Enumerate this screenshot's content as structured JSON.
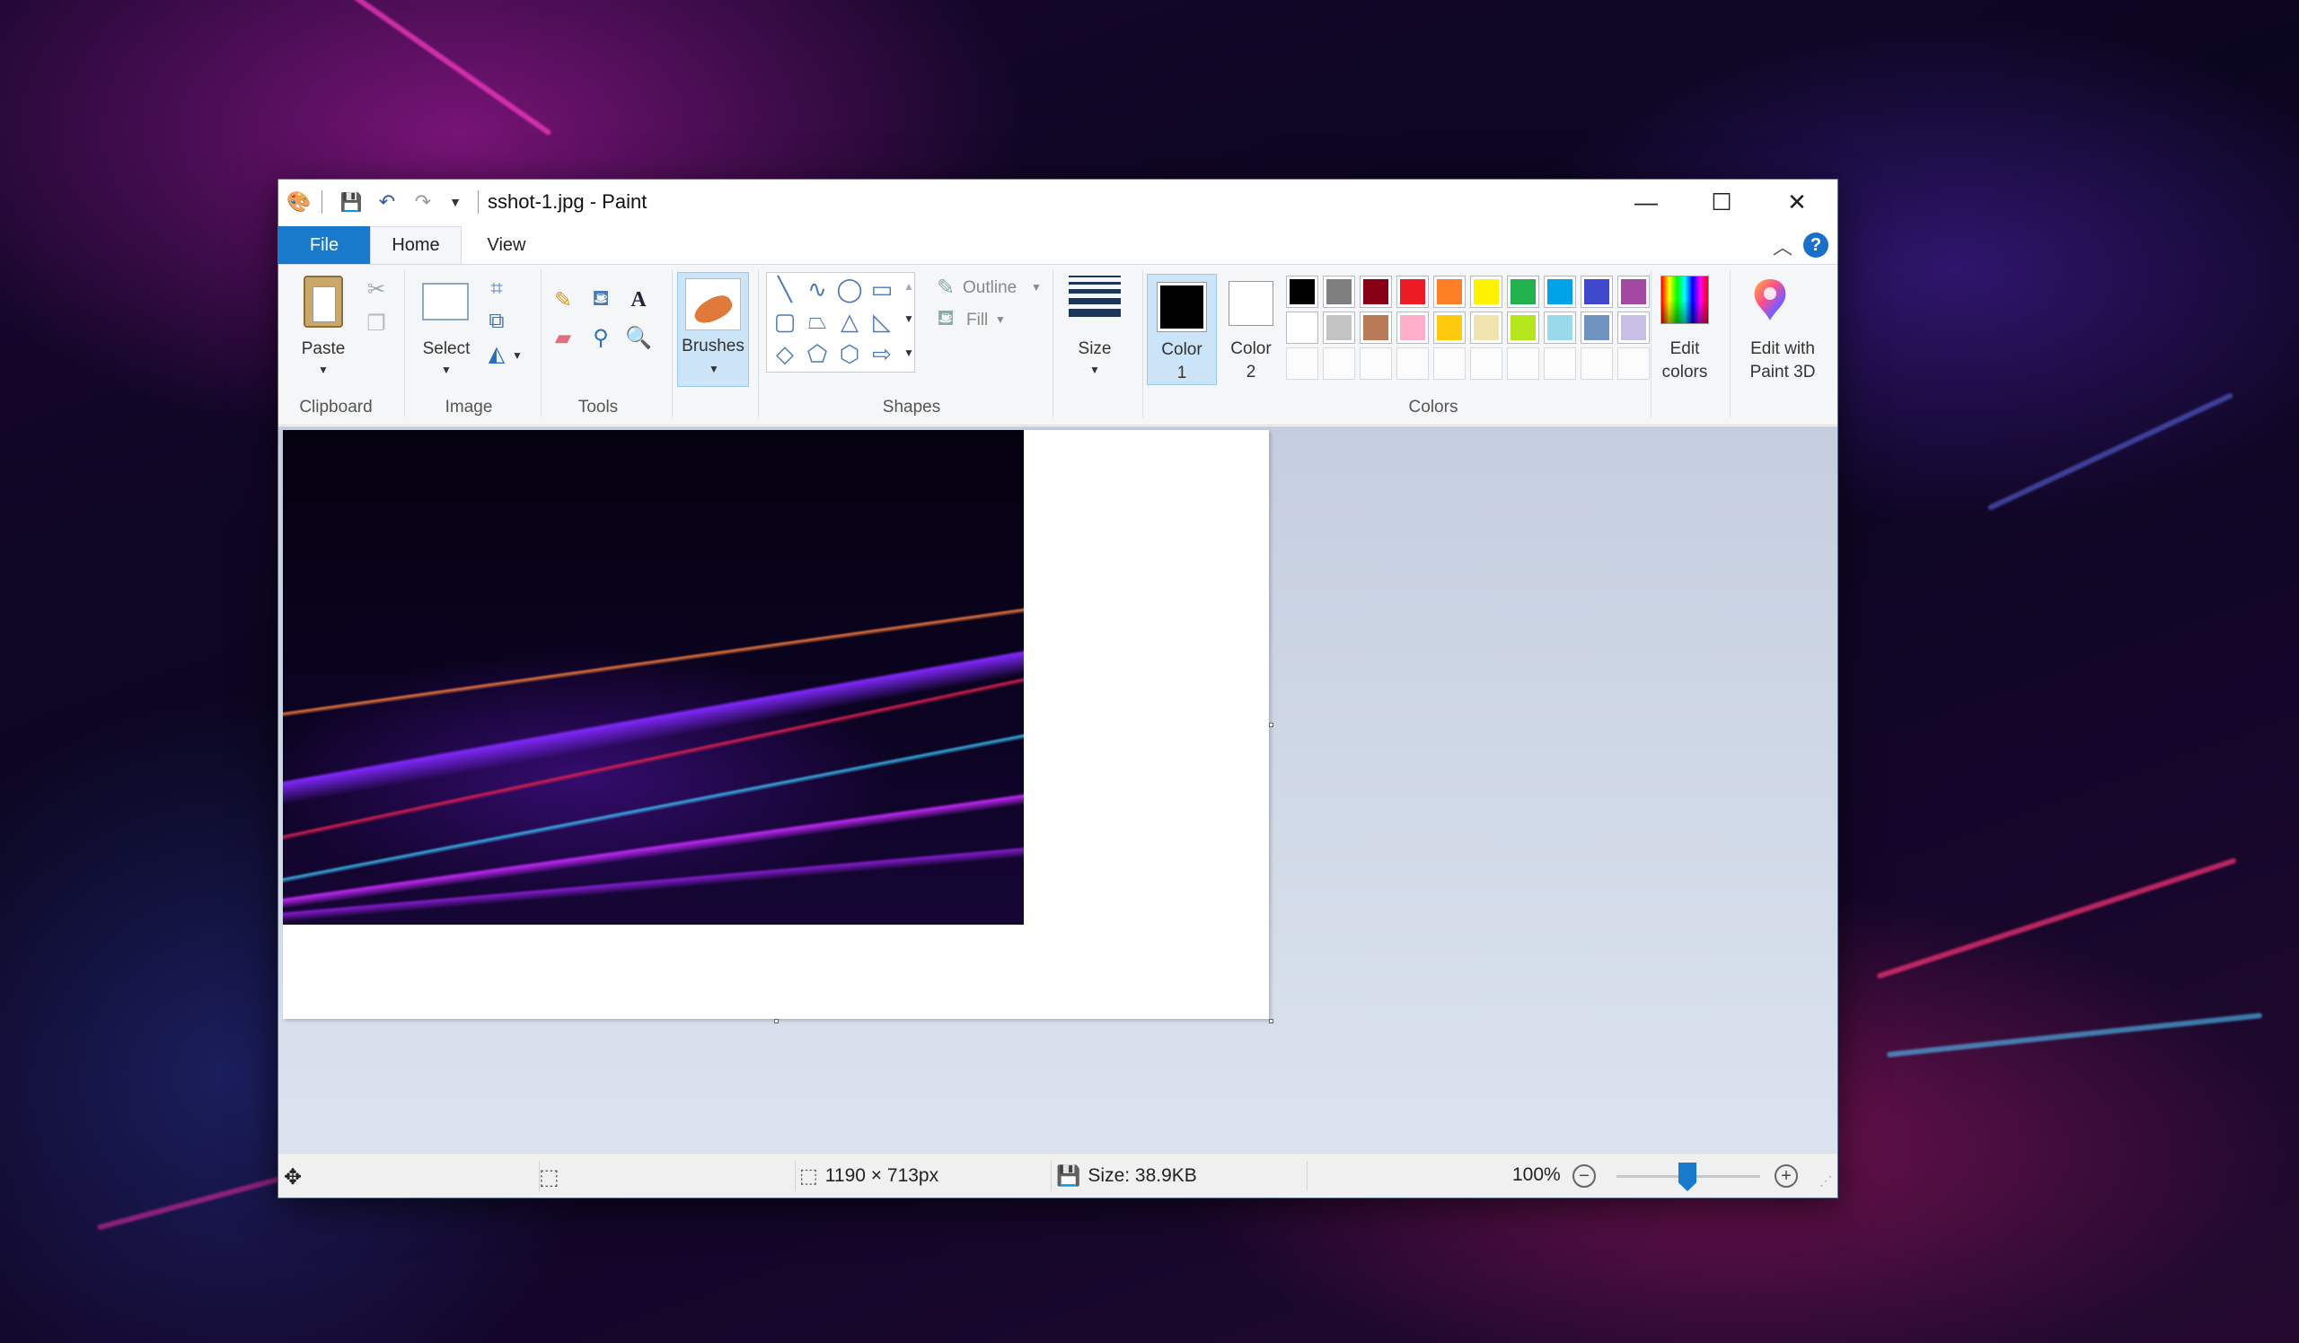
{
  "window": {
    "title": "sshot-1.jpg - Paint",
    "minimize": "—",
    "maximize": "☐",
    "close": "✕"
  },
  "tabs": {
    "file": "File",
    "home": "Home",
    "view": "View"
  },
  "ribbon": {
    "clipboard": {
      "paste": "Paste",
      "group": "Clipboard"
    },
    "image": {
      "select": "Select",
      "group": "Image"
    },
    "tools": {
      "group": "Tools"
    },
    "brushes": {
      "label": "Brushes"
    },
    "shapes": {
      "outline": "Outline",
      "fill": "Fill",
      "group": "Shapes"
    },
    "size": {
      "label": "Size"
    },
    "colors": {
      "color1_line1": "Color",
      "color1_line2": "1",
      "color2_line1": "Color",
      "color2_line2": "2",
      "edit_line1": "Edit",
      "edit_line2": "colors",
      "group": "Colors",
      "color1_value": "#000000",
      "color2_value": "#ffffff",
      "palette_row1": [
        "#000000",
        "#7f7f7f",
        "#880015",
        "#ed1c24",
        "#ff7f27",
        "#fff200",
        "#22b14c",
        "#00a2e8",
        "#3f48cc",
        "#a349a4"
      ],
      "palette_row2": [
        "#ffffff",
        "#c3c3c3",
        "#b97a57",
        "#ffaec9",
        "#ffc90e",
        "#efe4b0",
        "#b5e61d",
        "#99d9ea",
        "#7092be",
        "#c8bfe7"
      ]
    },
    "paint3d": {
      "line1": "Edit with",
      "line2": "Paint 3D"
    }
  },
  "status": {
    "dimensions": "1190 × 713px",
    "size": "Size: 38.9KB",
    "zoom": "100%",
    "zoom_level_percent": 100
  }
}
